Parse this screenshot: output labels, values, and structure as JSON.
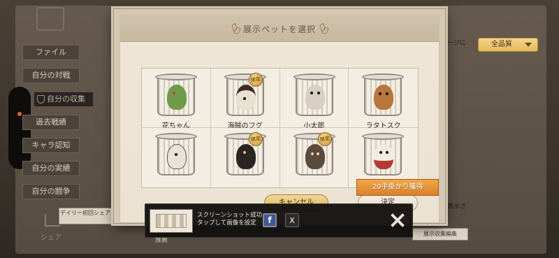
{
  "background": {
    "menu_items": [
      "ファイル",
      "自分の対戦",
      "自分の収集",
      "過去戦績",
      "キャラ認知",
      "自分の実績",
      "自分の闘争"
    ],
    "daily_share_label": "デイリー初回シェア",
    "share_label": "シェア",
    "right_text_1": "ージに",
    "right_text_2": "表示さ",
    "bottom_left_text": "推薦",
    "bottom_right_text": "展示収集編集"
  },
  "modal": {
    "title": "展示ペットを選択",
    "filter": {
      "selected": "全品質",
      "icon": "chevron-down-icon"
    },
    "pets": [
      {
        "name": "花ちゃん",
        "limited": false
      },
      {
        "name": "海賊のフグ",
        "limited": true
      },
      {
        "name": "小太郎",
        "limited": false
      },
      {
        "name": "ラタトスク",
        "limited": false
      },
      {
        "name": "",
        "limited": false
      },
      {
        "name": "",
        "limited": true
      },
      {
        "name": "",
        "limited": true
      },
      {
        "name": "",
        "limited": false
      }
    ],
    "limited_label": "限定",
    "cancel_label": "キャンセル",
    "confirm_label": "決定",
    "achievement_popup": "20手掛かり獲得"
  },
  "toast": {
    "line1": "スクリーンショット成功",
    "line2": "タップして画像を設定",
    "facebook_label": "f",
    "x_label": "X",
    "close_icon": "close-icon"
  },
  "colors": {
    "accent_gold": "#e5b95a",
    "achievement_orange": "#d9822a",
    "facebook_blue": "#3c5a9a"
  }
}
